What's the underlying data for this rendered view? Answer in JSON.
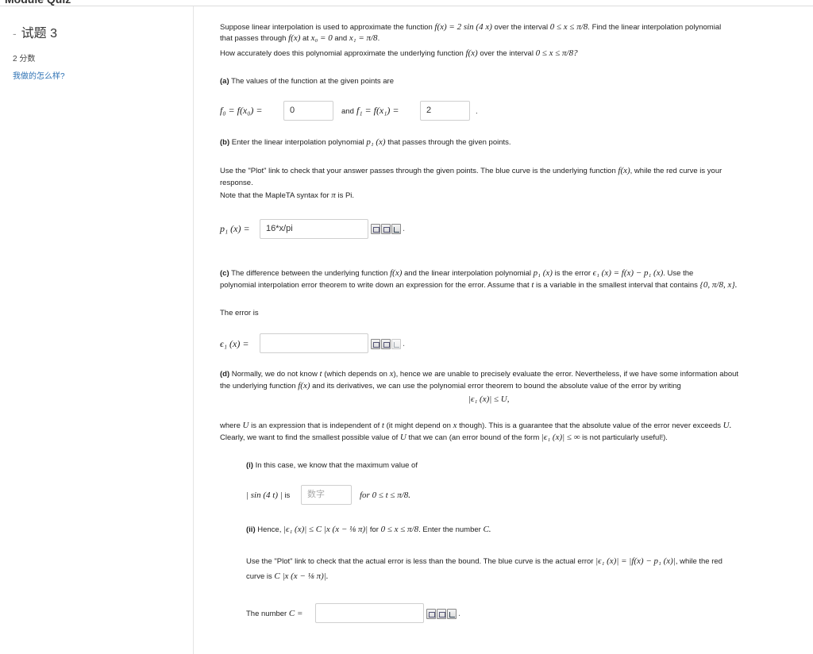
{
  "sidebar": {
    "question_title": "试题 3",
    "points": "2 分数",
    "how_did_i_do": "我做的怎么样?"
  },
  "intro": {
    "line1_prefix": "Suppose linear interpolation is used to approximate the function",
    "line1_func": "f(x) = 2 sin (4 x)",
    "line1_mid": "over the interval",
    "line1_interval": "0 ≤ x ≤ π/8",
    "line1_suffix": ". Find the linear interpolation polynomial",
    "line2_prefix": "that passes through",
    "line2_fx": "f(x)",
    "line2_at": "at",
    "line2_x0": "x₀ = 0",
    "line2_and": "and",
    "line2_x1": "x₁ = π/8",
    "line3_prefix": "How accurately does this polynomial approximate the underlying function",
    "line3_fx": "f(x)",
    "line3_mid": "over the interval",
    "line3_interval": "0 ≤ x ≤ π/8?"
  },
  "part_a": {
    "label": "(a)",
    "text": "The values of the function at the given points are",
    "f0_label": "f₀ = f(x₀) =",
    "f0_value": "0",
    "and": "and",
    "f1_label": "f₁ = f(x₁) =",
    "f1_value": "2",
    "period": "."
  },
  "part_b": {
    "label": "(b)",
    "text_prefix": "Enter the linear interpolation polynomial",
    "p1x": "p₁ (x)",
    "text_suffix": "that passes through the given points.",
    "plot_note_prefix": "Use the \"Plot\" link to check that your answer passes through the given points. The blue curve is the underlying function",
    "plot_note_fx": "f(x)",
    "plot_note_suffix": ", while the red curve is your",
    "plot_note_line2": "response.",
    "syntax_note_prefix": "Note that the MapleTA syntax for",
    "syntax_note_pi": "π",
    "syntax_note_suffix": "is Pi.",
    "p1_label": "p₁ (x) =",
    "p1_value": "16*x/pi"
  },
  "part_c": {
    "label": "(c)",
    "line1_prefix": "The difference between the underlying function",
    "line1_fx": "f(x)",
    "line1_mid": "and the linear interpolation polynomial",
    "line1_p1": "p₁ (x)",
    "line1_is": "is the error",
    "line1_eq": "ϵ₁ (x) = f(x) − p₁ (x)",
    "line1_suffix": ". Use the",
    "line2_prefix": "polynomial interpolation error theorem to write down an expression for the error. Assume that",
    "line2_t": "t",
    "line2_suffix": "is a variable in the smallest interval that contains",
    "line2_set": "{0, π/8, x}.",
    "error_is": "The error is",
    "e1_label": "ϵ₁ (x) =",
    "e1_value": ""
  },
  "part_d": {
    "label": "(d)",
    "line1": "Normally, we do not know",
    "line1_t": "t",
    "line1_b": "(which depends on",
    "line1_x": "x",
    "line1_c": "), hence we are unable to precisely evaluate the error. Nevertheless, if we have some information about",
    "line2_prefix": "the underlying function",
    "line2_fx": "f(x)",
    "line2_suffix": "and its derivatives, we can use the polynomial error theorem to bound the absolute value of the error by writing",
    "bound_eq": "|ϵ₁ (x)| ≤ U,",
    "where_prefix": "where",
    "where_U": "U",
    "where_mid": "is an expression that is independent of",
    "where_t": "t",
    "where_mid2": "(it might depend on",
    "where_x": "x",
    "where_suffix": "though). This is a guarantee that the absolute value of the error never exceeds",
    "where_U2": "U.",
    "clearly_prefix": "Clearly, we want to find the smallest possible value of",
    "clearly_U": "U",
    "clearly_mid": "that we can (an error bound of the form",
    "clearly_eq": "|ϵ₁ (x)| ≤ ∞",
    "clearly_suffix": "is not particularly useful!).",
    "i_label": "(i)",
    "i_text": "In this case, we know that the maximum value of",
    "i_abs": "| sin (4 t) |",
    "i_is": "is",
    "i_placeholder": "数字",
    "i_range": "for 0 ≤ t ≤ π/8.",
    "ii_label": "(ii)",
    "ii_text": "Hence,",
    "ii_eq": "|ϵ₁ (x)| ≤ C |x (x − ⅛ π)|",
    "ii_range": "for",
    "ii_interval": "0 ≤ x ≤ π/8",
    "ii_suffix": ". Enter the number",
    "ii_C": "C.",
    "plot2_prefix": "Use the \"Plot\" link to check that the actual error is less than the bound. The blue curve is the actual error",
    "plot2_eq": "|ϵ₁ (x)| = |f(x) − p₁ (x)|",
    "plot2_suffix": ", while the red",
    "plot2_line2": "curve is",
    "plot2_eq2": "C |x (x − ⅛ π)|.",
    "c_label": "The number",
    "c_eq": "C =",
    "c_value": ""
  }
}
